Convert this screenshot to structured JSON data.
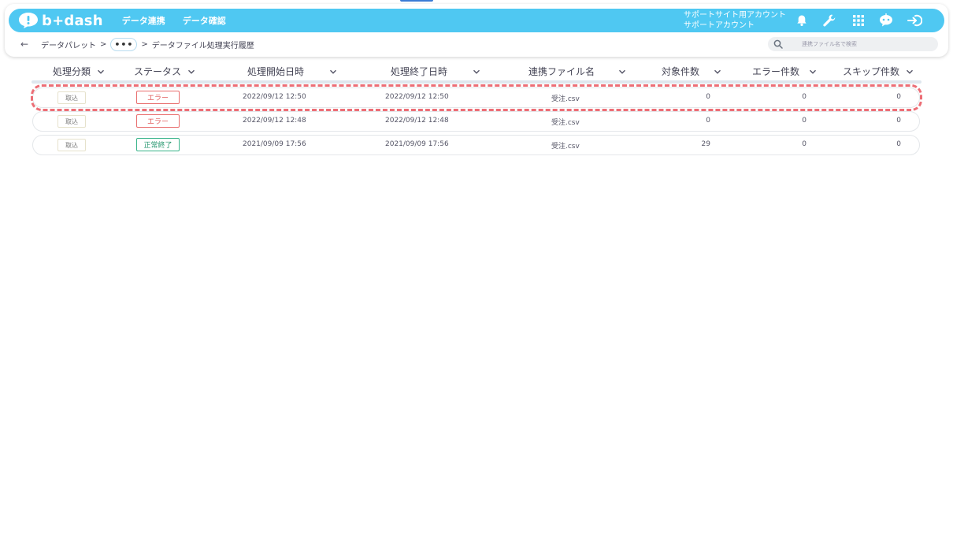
{
  "header": {
    "logo_text": "b+dash",
    "nav": [
      "データ連携",
      "データ確認"
    ],
    "account_line1": "サポートサイト用アカウント",
    "account_line2": "サポートアカウント",
    "icons": [
      "bell-icon",
      "wrench-icon",
      "grid-icon",
      "chat-bot-icon",
      "logout-icon"
    ],
    "accent_color": "#4fc8f2"
  },
  "breadcrumb": {
    "back_label": "←",
    "parent": "データパレット",
    "sep1": ">",
    "more": "•••",
    "sep2": ">",
    "current": "データファイル処理実行履歴"
  },
  "search": {
    "placeholder": "連携ファイル名で検索"
  },
  "table": {
    "columns": [
      "処理分類",
      "ステータス",
      "処理開始日時",
      "処理終了日時",
      "連携ファイル名",
      "対象件数",
      "エラー件数",
      "スキップ件数"
    ],
    "rows": [
      {
        "category": "取込",
        "status": "エラー",
        "status_kind": "error",
        "start": "2022/09/12 12:50",
        "end": "2022/09/12 12:50",
        "file": "受注.csv",
        "target": "0",
        "errors": "0",
        "skips": "0"
      },
      {
        "category": "取込",
        "status": "エラー",
        "status_kind": "error",
        "start": "2022/09/12 12:48",
        "end": "2022/09/12 12:48",
        "file": "受注.csv",
        "target": "0",
        "errors": "0",
        "skips": "0"
      },
      {
        "category": "取込",
        "status": "正常終了",
        "status_kind": "ok",
        "start": "2021/09/09 17:56",
        "end": "2021/09/09 17:56",
        "file": "受注.csv",
        "target": "29",
        "errors": "0",
        "skips": "0"
      }
    ]
  },
  "colors": {
    "error": "#e05b5b",
    "ok": "#23956c",
    "highlight": "#ec6e76"
  }
}
